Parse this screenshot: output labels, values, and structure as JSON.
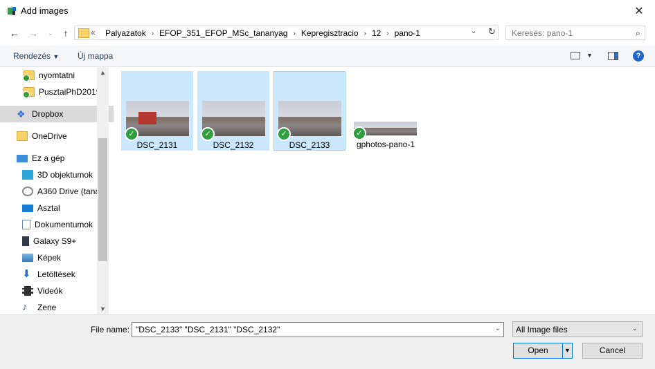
{
  "window": {
    "title": "Add images"
  },
  "address": {
    "prefix": "«",
    "crumbs": [
      "Palyazatok",
      "EFOP_351_EFOP_MSc_tananyag",
      "Kepregisztracio",
      "12",
      "pano-1"
    ]
  },
  "search": {
    "placeholder": "Keresés: pano-1"
  },
  "toolbar": {
    "organize": "Rendezés",
    "new_folder": "Új mappa"
  },
  "sidebar": {
    "items": [
      {
        "label": "nyomtatni",
        "icon": "synced-folder-icon"
      },
      {
        "label": "PusztaiPhD2019",
        "icon": "synced-folder-icon"
      },
      {
        "label": "Dropbox",
        "icon": "dropbox-icon"
      },
      {
        "label": "OneDrive",
        "icon": "folder-icon"
      },
      {
        "label": "Ez a gép",
        "icon": "computer-icon"
      },
      {
        "label": "3D objektumok",
        "icon": "cube-icon"
      },
      {
        "label": "A360 Drive (tana",
        "icon": "drive-icon"
      },
      {
        "label": "Asztal",
        "icon": "desktop-icon"
      },
      {
        "label": "Dokumentumok",
        "icon": "document-icon"
      },
      {
        "label": "Galaxy S9+",
        "icon": "phone-icon"
      },
      {
        "label": "Képek",
        "icon": "pictures-icon"
      },
      {
        "label": "Letöltések",
        "icon": "download-icon"
      },
      {
        "label": "Videók",
        "icon": "video-icon"
      },
      {
        "label": "Zene",
        "icon": "music-icon"
      }
    ]
  },
  "files": [
    {
      "label": "DSC_2131"
    },
    {
      "label": "DSC_2132"
    },
    {
      "label": "DSC_2133"
    },
    {
      "label": "gphotos-pano-1"
    }
  ],
  "bottom": {
    "file_name_label": "File name:",
    "file_name_value": "\"DSC_2133\" \"DSC_2131\" \"DSC_2132\"",
    "file_type": "All Image files",
    "open": "Open",
    "cancel": "Cancel"
  },
  "colors": {
    "selection": "#cce8ff",
    "accent": "#0078d7",
    "check": "#2f9e3f"
  }
}
